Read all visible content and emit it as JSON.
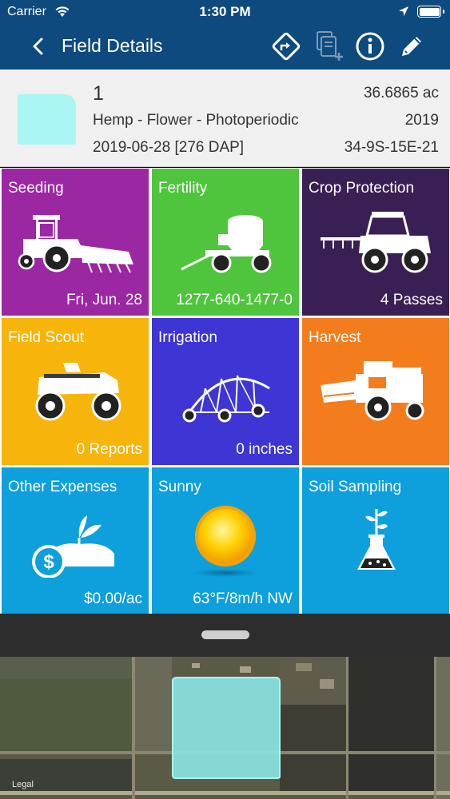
{
  "status_bar": {
    "carrier": "Carrier",
    "time": "1:30 PM"
  },
  "header": {
    "title": "Field Details"
  },
  "field": {
    "name": "1",
    "crop": "Hemp - Flower - Photoperiodic",
    "date": "2019-06-28 [276 DAP]",
    "area": "36.6865 ac",
    "year": "2019",
    "location": "34-9S-15E-21",
    "color": "#aaf6f4"
  },
  "tiles": [
    {
      "title": "Seeding",
      "subtitle": "Fri, Jun. 28",
      "color": "#9b27a3",
      "icon": "tractor-seeder-icon"
    },
    {
      "title": "Fertility",
      "subtitle": "1277-640-1477-0",
      "color": "#4ec53c",
      "icon": "fertilizer-cart-icon"
    },
    {
      "title": "Crop Protection",
      "subtitle": "4 Passes",
      "color": "#3a1f55",
      "icon": "sprayer-tractor-icon"
    },
    {
      "title": "Field Scout",
      "subtitle": "0 Reports",
      "color": "#f7b40a",
      "icon": "atv-icon"
    },
    {
      "title": "Irrigation",
      "subtitle": "0 inches",
      "color": "#3e35d4",
      "icon": "pivot-irrigation-icon"
    },
    {
      "title": "Harvest",
      "subtitle": "",
      "color": "#f37d1c",
      "icon": "combine-harvester-icon"
    },
    {
      "title": "Other Expenses",
      "subtitle": "$0.00/ac",
      "color": "#0da0dc",
      "icon": "dollar-plant-icon"
    },
    {
      "title": "Sunny",
      "subtitle": "63°F/8m/h NW",
      "color": "#0da0dc",
      "icon": "sun-icon"
    },
    {
      "title": "Soil Sampling",
      "subtitle": "",
      "color": "#0da0dc",
      "icon": "flask-sprout-icon"
    }
  ],
  "map": {
    "legal_label": "Legal"
  }
}
